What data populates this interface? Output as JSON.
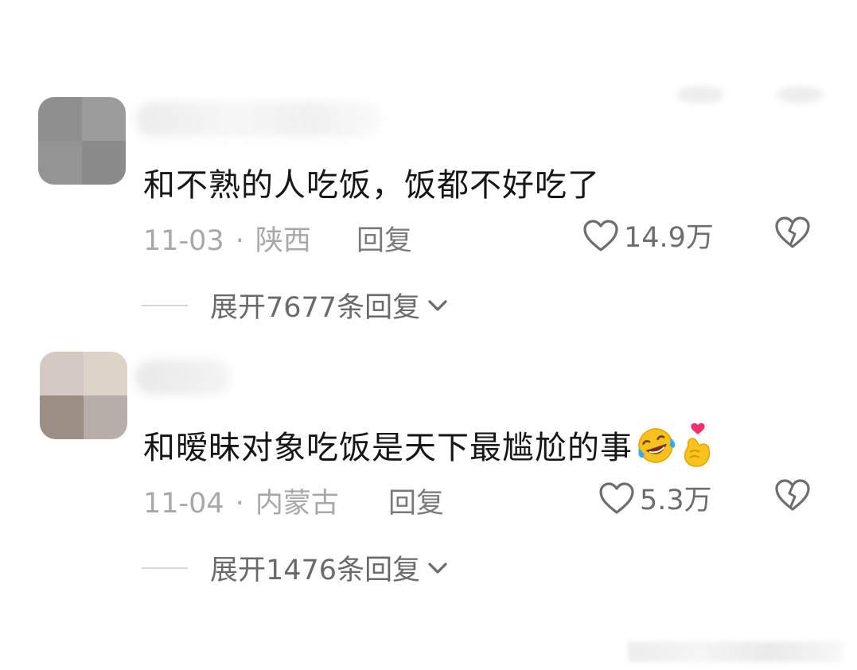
{
  "comments": [
    {
      "text": "和不熟的人吃饭，饭都不好吃了",
      "date": "11-03",
      "separator": "·",
      "location": "陕西",
      "reply_label": "回复",
      "likes": "14.9万",
      "expand_label": "展开7677条回复"
    },
    {
      "text": "和暧昧对象吃饭是天下最尴尬的事",
      "date": "11-04",
      "separator": "·",
      "location": "内蒙古",
      "reply_label": "回复",
      "likes": "5.3万",
      "expand_label": "展开1476条回复",
      "emojis": [
        "laughing-crying-emoji",
        "finger-heart-emoji"
      ]
    }
  ],
  "colors": {
    "text": "#161616",
    "meta": "#a8a8a8",
    "action": "#6d6d6d",
    "background": "#ffffff"
  }
}
